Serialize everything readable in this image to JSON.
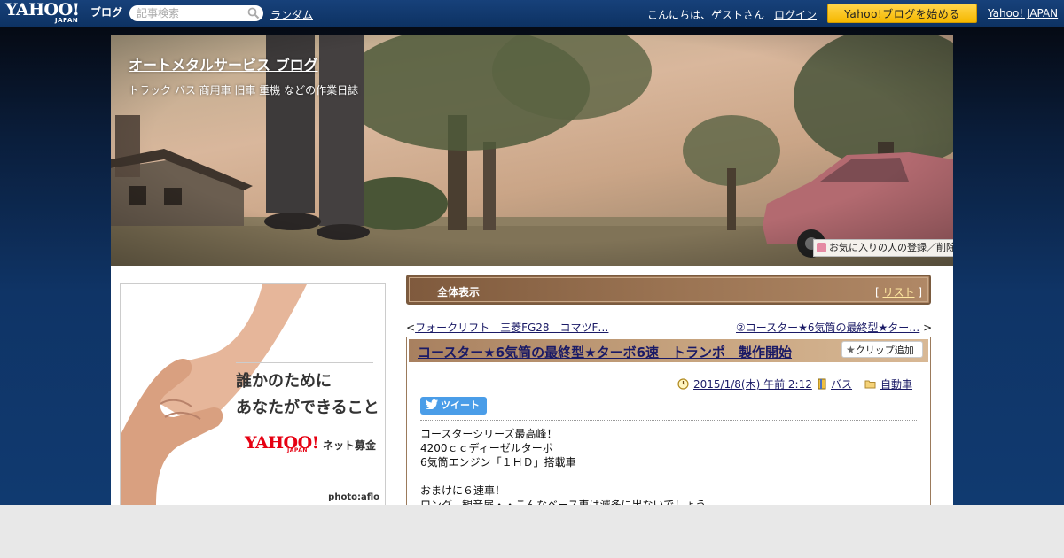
{
  "topbar": {
    "logo_main": "YAHOO!",
    "logo_sub": "JAPAN",
    "logo_product": "ブログ",
    "search_placeholder": "記事検索",
    "random_link": "ランダム",
    "greeting": "こんにちは、ゲストさん",
    "login_link": "ログイン",
    "start_button": "Yahoo!ブログを始める",
    "yahoo_japan_link": "Yahoo! JAPAN"
  },
  "header": {
    "blog_title": "オートメタルサービス ブログ",
    "blog_description": "トラック バス 商用車 旧車 重機 などの作業日誌",
    "favorite_button": "お気に入りの人の登録／削除"
  },
  "ad": {
    "line1": "誰かのために",
    "line2": "あなたができること",
    "brand_main": "YAHOO!",
    "brand_jp": "JAPAN",
    "brand_sub": "ネット募金",
    "credit": "photo:aflo"
  },
  "section": {
    "title": "全体表示",
    "list_link": "リスト"
  },
  "nav": {
    "prev_label": "フォークリフト　三菱FG28　コマツF…",
    "next_label": "②コースター★6気筒の最終型★ター…"
  },
  "article": {
    "title": "コースター★6気筒の最終型★ターボ6速　トランポ　製作開始",
    "clip_button": "クリップ追加",
    "date": "2015/1/8(木) 午前 2:12",
    "tag_bus": "バス",
    "category": "自動車",
    "tweet_button": "ツイート",
    "body": [
      "コースターシリーズ最高峰！",
      "4200ｃｃディーゼルターボ",
      "6気筒エンジン「１ＨＤ」搭載車",
      "",
      "おまけに６速車！",
      "ロング、観音扉・・こんなベース車は滅多に出ないでしょう"
    ]
  },
  "colors": {
    "topbar": "#0d3263",
    "start_button": "#f6b800",
    "section_bar": "#9a7352",
    "link": "#1a1a66"
  }
}
